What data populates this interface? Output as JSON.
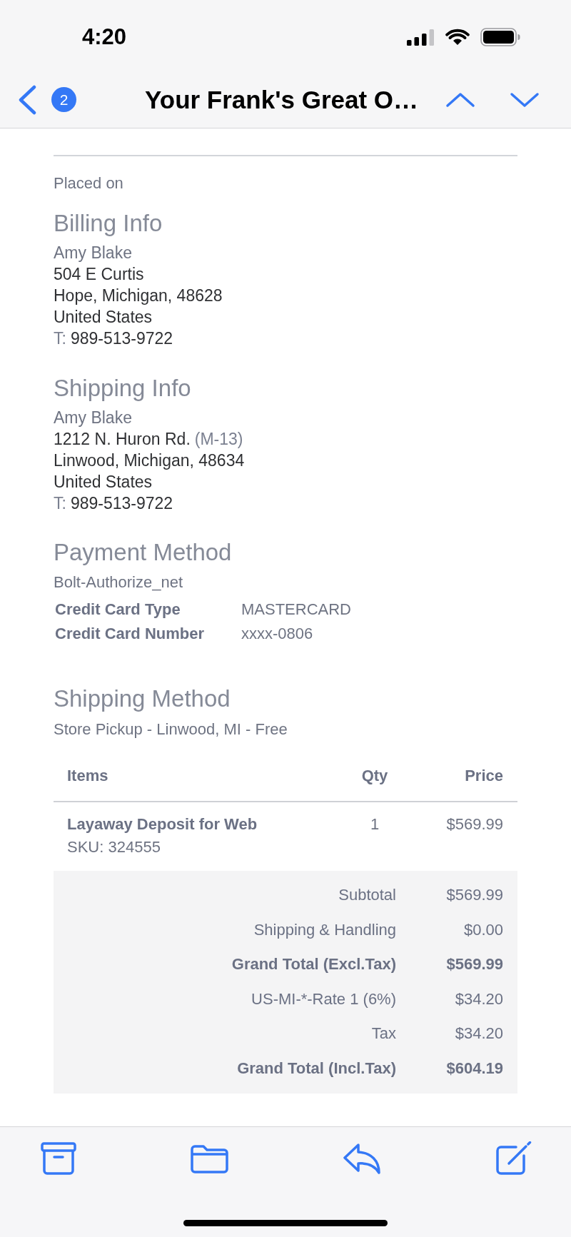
{
  "status_bar": {
    "time": "4:20"
  },
  "nav_bar": {
    "unread_count": "2",
    "title": "Your Frank's Great O…"
  },
  "order": {
    "placed_on": "Placed on"
  },
  "billing_info": {
    "heading": "Billing Info",
    "name": "Amy Blake",
    "address_lines": [
      {
        "text": "504 E Curtis"
      },
      {
        "text": "Hope, Michigan, 48628"
      },
      {
        "text": "United States"
      }
    ],
    "phone": {
      "label": "T:",
      "number": "989-513-9722"
    }
  },
  "shipping_info": {
    "heading": "Shipping Info",
    "name": "Amy Blake",
    "address_lines": [
      {
        "text": "1212 N. Huron Rd.",
        "note": "(M-13)"
      },
      {
        "text": "Linwood, Michigan, 48634"
      },
      {
        "text": "United States"
      }
    ],
    "phone": {
      "label": "T:",
      "number": "989-513-9722"
    }
  },
  "payment_method": {
    "heading": "Payment Method",
    "name": "Bolt-Authorize_net",
    "details": [
      {
        "label": "Credit Card Type",
        "value": "MASTERCARD"
      },
      {
        "label": "Credit Card Number",
        "value": "xxxx-0806"
      }
    ]
  },
  "shipping_method": {
    "heading": "Shipping Method",
    "description": "Store Pickup - Linwood, MI - Free"
  },
  "items_table": {
    "columns": [
      "Items",
      "Qty",
      "Price"
    ],
    "rows": [
      {
        "name": "Layaway Deposit for Web",
        "sku": "SKU: 324555",
        "qty": "1",
        "price": "$569.99"
      }
    ]
  },
  "totals": [
    {
      "kind": "line",
      "label": "Subtotal",
      "value": "$569.99"
    },
    {
      "kind": "line",
      "label": "Shipping & Handling",
      "value": "$0.00"
    },
    {
      "kind": "grand_total",
      "label": "Grand Total (Excl.Tax)",
      "value": "$569.99"
    },
    {
      "kind": "line",
      "label": "US-MI-*-Rate 1 (6%)",
      "value": "$34.20"
    },
    {
      "kind": "line",
      "label": "Tax",
      "value": "$34.20"
    },
    {
      "kind": "grand_total",
      "label": "Grand Total (Incl.Tax)",
      "value": "$604.19"
    }
  ]
}
